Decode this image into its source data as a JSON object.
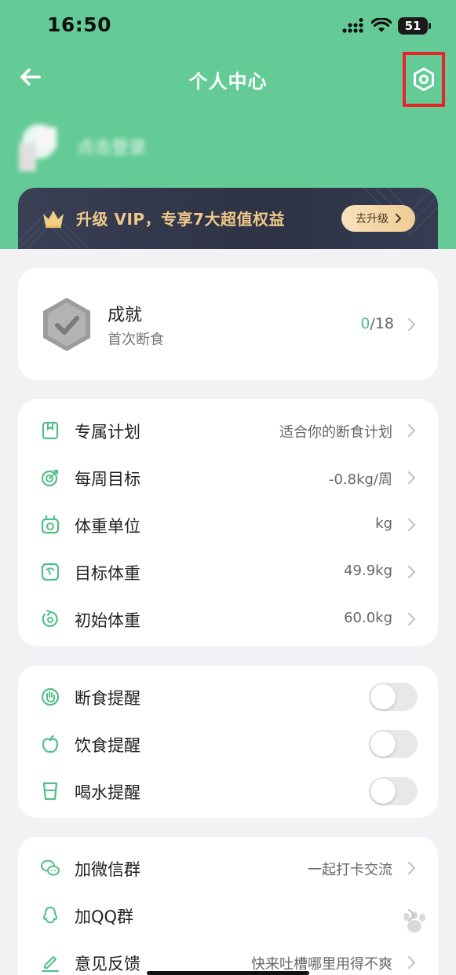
{
  "status_bar": {
    "time": "16:50",
    "battery": "51"
  },
  "nav": {
    "title": "个人中心"
  },
  "profile": {
    "login_text": "点击登录"
  },
  "vip": {
    "text": "升级 VIP，专享7大超值权益",
    "button": "去升级"
  },
  "achievement": {
    "title": "成就",
    "subtitle": "首次断食",
    "count_done": "0",
    "count_total": "/18"
  },
  "plan": {
    "items": [
      {
        "label": "专属计划",
        "value": "适合你的断食计划",
        "icon": "plan-icon"
      },
      {
        "label": "每周目标",
        "value": "-0.8kg/周",
        "icon": "target-icon"
      },
      {
        "label": "体重单位",
        "value": "kg",
        "icon": "scale-icon"
      },
      {
        "label": "目标体重",
        "value": "49.9kg",
        "icon": "goal-weight-icon"
      },
      {
        "label": "初始体重",
        "value": "60.0kg",
        "icon": "initial-weight-icon"
      }
    ]
  },
  "reminders": {
    "items": [
      {
        "label": "断食提醒",
        "enabled": false,
        "icon": "fasting-hand-icon"
      },
      {
        "label": "饮食提醒",
        "enabled": false,
        "icon": "apple-icon"
      },
      {
        "label": "喝水提醒",
        "enabled": false,
        "icon": "cup-icon"
      }
    ]
  },
  "social": {
    "items": [
      {
        "label": "加微信群",
        "value": "一起打卡交流",
        "icon": "wechat-icon"
      },
      {
        "label": "加QQ群",
        "value": "",
        "icon": "qq-icon"
      },
      {
        "label": "意见反馈",
        "value": "快来吐槽哪里用得不爽",
        "icon": "edit-icon"
      }
    ]
  },
  "colors": {
    "brand_green": "#64cb96",
    "accent_green": "#4fbf87",
    "vip_gold": "#f0c98a",
    "highlight_red": "#e8242a"
  }
}
